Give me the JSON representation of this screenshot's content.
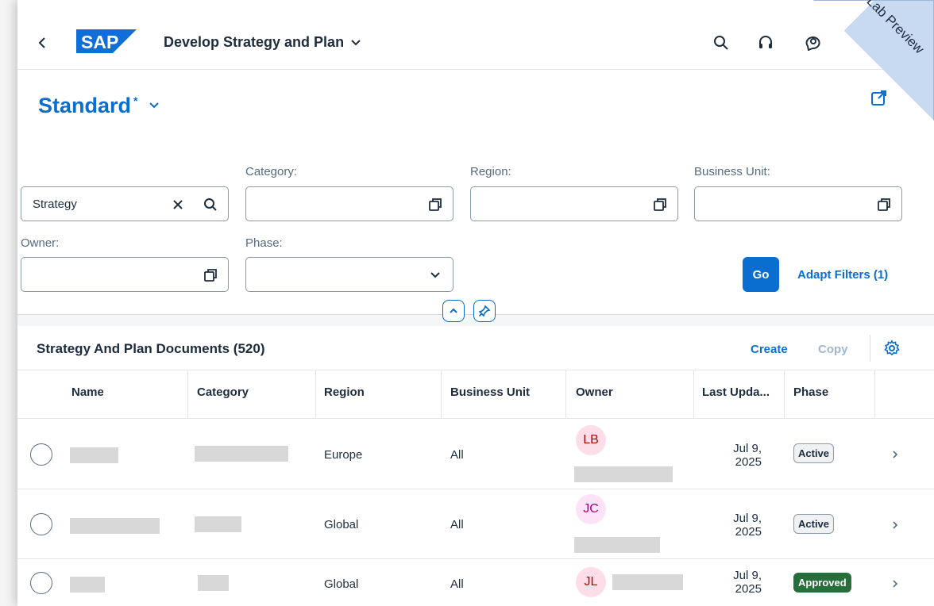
{
  "shell": {
    "app_title": "Develop Strategy and Plan",
    "logo_text": "SAP",
    "ribbon_text": "Lab Preview",
    "colors": {
      "brand": "#0a6ed1",
      "logo": "#0f6fd6"
    }
  },
  "variant": {
    "name": "Standard",
    "modified_marker": "*"
  },
  "filters": {
    "search": {
      "value": "Strategy"
    },
    "category": {
      "label": "Category:",
      "value": ""
    },
    "region": {
      "label": "Region:",
      "value": ""
    },
    "business_unit": {
      "label": "Business Unit:",
      "value": ""
    },
    "owner": {
      "label": "Owner:",
      "value": ""
    },
    "phase": {
      "label": "Phase:",
      "value": ""
    },
    "go_label": "Go",
    "adapt_label": "Adapt Filters (1)"
  },
  "table": {
    "title": "Strategy And Plan Documents (520)",
    "create_label": "Create",
    "copy_label": "Copy",
    "columns": [
      "Name",
      "Category",
      "Region",
      "Business Unit",
      "Owner",
      "Last Upda...",
      "Phase"
    ],
    "rows": [
      {
        "region": "Europe",
        "business_unit": "All",
        "owner_initials": "LB",
        "date_line1": "Jul 9,",
        "date_line2": "2025",
        "phase": "Active"
      },
      {
        "region": "Global",
        "business_unit": "All",
        "owner_initials": "JC",
        "date_line1": "Jul 9,",
        "date_line2": "2025",
        "phase": "Active"
      },
      {
        "region": "Global",
        "business_unit": "All",
        "owner_initials": "JL",
        "date_line1": "Jul 9,",
        "date_line2": "2025",
        "phase": "Approved"
      }
    ]
  }
}
